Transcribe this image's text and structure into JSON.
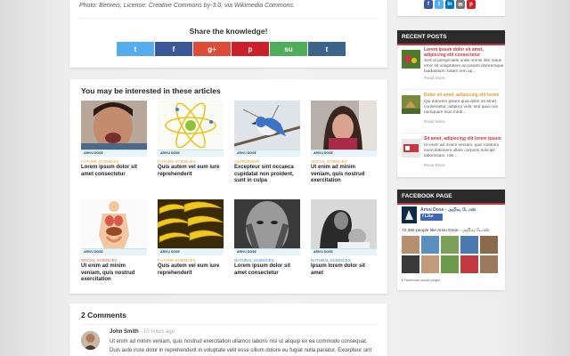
{
  "top": {
    "photo_credit": "Photo: Benreis, License: Creative Commons by-3.0, via Wikimedia Commons.",
    "share_title": "Share the knowledge!",
    "share_buttons": [
      {
        "icon": "twitter-icon",
        "glyph": "t",
        "color": "#55acee"
      },
      {
        "icon": "facebook-icon",
        "glyph": "f",
        "color": "#3b5998"
      },
      {
        "icon": "google-plus-icon",
        "glyph": "g+",
        "color": "#dd4b39"
      },
      {
        "icon": "pinterest-icon",
        "glyph": "p",
        "color": "#cb2027"
      },
      {
        "icon": "stumbleupon-icon",
        "glyph": "su",
        "color": "#4fae5a"
      },
      {
        "icon": "tumblr-icon",
        "glyph": "t",
        "color": "#3c6589"
      }
    ]
  },
  "related": {
    "title": "You may be interested in these articles",
    "brand": "ARIVU DOSE",
    "items": [
      {
        "category": "FUTURE SCIENCES",
        "cat_color": "#e69b2b",
        "title": "Lorem ipsum dolor sit amet consectetur"
      },
      {
        "category": "FUTURE SCIENCES",
        "cat_color": "#e69b2b",
        "title": "Quis autem vel eum iure reprehenderit"
      },
      {
        "category": "ASTRONOMY",
        "cat_color": "#e69b2b",
        "title": "Excepteur sint occaeca cupidatat non proident, sunt in culpa"
      },
      {
        "category": "SOCIAL SCIENCES",
        "cat_color": "#e69b2b",
        "title": "Ut enim ad minim veniam, quis nostrud exercitation"
      },
      {
        "category": "SOCIAL SCIENCES",
        "cat_color": "#e0533a",
        "title": "Ut enim ad minim veniam, quis nostrud exercitation"
      },
      {
        "category": "FUTURE SCIENCES",
        "cat_color": "#e69b2b",
        "title": "Quis autem vel eum iure reprehenderit"
      },
      {
        "category": "NATURAL SCIENCES",
        "cat_color": "#3f7fbf",
        "title": "Lorem ipsum dolor sit amet consectetur"
      },
      {
        "category": "NATURAL SCIENCES",
        "cat_color": "#3f7fbf",
        "title": "Ipsum lorem dolor sit amet"
      }
    ]
  },
  "comments": {
    "title": "2 Comments",
    "author": "John Smith",
    "time": "· 10 hours ago",
    "text": "Ut enim ad minim veniam, quis nostrud exercitation ullamco laboris nisi ut aliquip ex ea commodo consequat. Duis aute irure dolor in reprehenderit in voluptate velit esse cillum dolore eu fugiat nulla pariatur. Excepteur sint"
  },
  "sidebar": {
    "social": [
      {
        "icon": "facebook-icon",
        "glyph": "f",
        "color": "#3b5998"
      },
      {
        "icon": "twitter-icon",
        "glyph": "t",
        "color": "#55acee"
      },
      {
        "icon": "linkedin-icon",
        "glyph": "in",
        "color": "#0077b5"
      },
      {
        "icon": "email-icon",
        "glyph": "✉",
        "color": "#777777"
      },
      {
        "icon": "pinterest-icon",
        "glyph": "p",
        "color": "#cb2027"
      }
    ],
    "recent_title": "RECENT POSTS",
    "recent": [
      {
        "title": "Lorem ipsum dolor sit amet, adipiscing elit consectetur",
        "title_color": "#c4383f",
        "excerpt": "Sed ut perspiciatis unde omnis iste natus error sit voluptatem accusanti doloremque laudantium, totam rem ap...",
        "more": "Read More"
      },
      {
        "title": "Dolor sit amet, adipiscing elit lorem",
        "title_color": "#e69b2b",
        "excerpt": "Qui dolorem ipsum quia dolor sit amet, consectetur, adipisci velit, sed quia non numquam eius modi...",
        "more": "Read More"
      },
      {
        "title": "Sit amet, adipiscing elit lorem ipsum",
        "title_color": "#c4383f",
        "excerpt": "Ut enim ad minim veniam, quis nostrum exercitationem ullam corporis suscipit laboriosam, nisi...",
        "more": "Read More"
      }
    ],
    "fb_title": "FACEBOOK PAGE",
    "fb_name": "Arivu Dose - அறிவு டோஸ்",
    "fb_like": "Like",
    "fb_count": "72,356 people like Arivu Dose - அறிவு டோஸ்.",
    "fb_plugin": "Facebook social plugin"
  }
}
